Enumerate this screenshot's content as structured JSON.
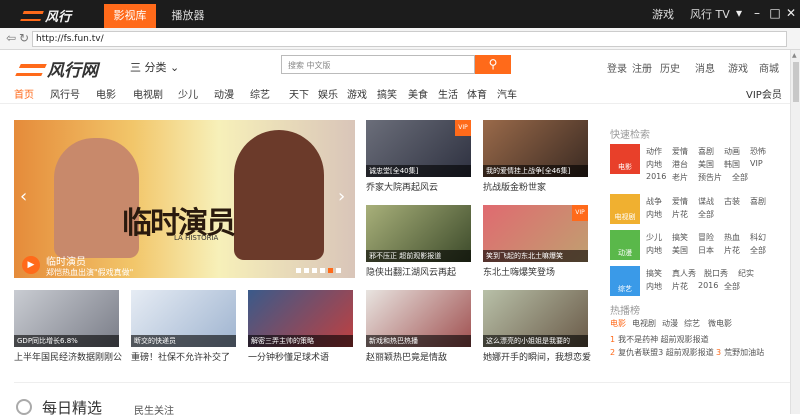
{
  "titlebar": {
    "logo": "风行",
    "tab_movies": "影视库",
    "tab_player": "播放器",
    "games": "游戏",
    "tv": "风行 TV"
  },
  "addressbar": {
    "url": "http://fs.fun.tv/"
  },
  "header": {
    "logo": "风行网",
    "category": "三 分类",
    "search_placeholder": "搜索 中文版",
    "links": [
      "登录",
      "注册",
      "历史",
      "消息",
      "游戏",
      "商城"
    ]
  },
  "nav": [
    "首页",
    "风行号",
    "电影",
    "电视剧",
    "少儿",
    "动漫",
    "综艺",
    "天下",
    "娱乐",
    "游戏",
    "搞笑",
    "美食",
    "生活",
    "体育",
    "汽车"
  ],
  "nav_vip": "VIP会员",
  "hero": {
    "big_text": "临时演员",
    "sub_text": "LA HISTORIA",
    "title": "临时演员",
    "subtitle": "郑恺热血出演\"假戏真做\""
  },
  "cards_row1": [
    {
      "cap": "诚忠堂[全40集]",
      "title": "乔家大院再起风云"
    },
    {
      "cap": "我的爱情挂上战争[全46集]",
      "title": "抗战版金粉世家"
    },
    {
      "cap": "邪不压正 超前观影报道",
      "title": "隐侠出翻江湖风云再起"
    },
    {
      "cap": "笑到飞起的东北土嘛爆笑",
      "title": "东北土嗨爆笑登场"
    }
  ],
  "cards_row2": [
    {
      "cap": "GDP同比增长6.8%",
      "title": "上半年国民经济数据刚刚公"
    },
    {
      "cap": "断交的快递员",
      "title": "重磅！社保不允许补交了"
    },
    {
      "cap": "解密三弄主帅的策略",
      "title": "一分钟秒懂足球术语"
    },
    {
      "cap": "新戏和热巴热播",
      "title": "赵丽颖热巴竟是情敌"
    },
    {
      "cap": "这么漂亮的小姐姐是我要的",
      "title": "她娜开手的瞬间，我想恋爱"
    }
  ],
  "quick_search": {
    "title": "快速检索",
    "blocks": [
      {
        "label": "电影",
        "rows": [
          [
            "动作",
            "爱情",
            "喜剧",
            "动画",
            "恐怖"
          ],
          [
            "内地",
            "港台",
            "美国",
            "韩国",
            "VIP"
          ],
          [
            "2016",
            "老片",
            "预告片",
            "全部"
          ]
        ]
      },
      {
        "label": "电视剧",
        "rows": [
          [
            "战争",
            "爱情",
            "谍战",
            "古装",
            "喜剧"
          ],
          [
            "内地",
            "片花",
            "全部"
          ]
        ]
      },
      {
        "label": "动漫",
        "rows": [
          [
            "少儿",
            "搞笑",
            "冒险",
            "热血",
            "科幻"
          ],
          [
            "内地",
            "美国",
            "日本",
            "片花",
            "全部"
          ]
        ]
      },
      {
        "label": "综艺",
        "rows": [
          [
            "搞笑",
            "真人秀",
            "脱口秀",
            "纪实"
          ],
          [
            "内地",
            "片花",
            "2016",
            "全部"
          ]
        ]
      }
    ]
  },
  "hot": {
    "title": "热播榜",
    "tabs": [
      "电影",
      "电视剧",
      "动漫",
      "综艺",
      "微电影"
    ],
    "items": [
      "我不是药神 超前观影报道",
      "复仇者联盟3 超前观影报道",
      "荒野加油站"
    ]
  },
  "daily": {
    "title": "每日精选",
    "sub": "民生关注"
  },
  "colors": {
    "accent": "#ff6a1a",
    "titlebar": "#1c1c1c",
    "movie": "#e8402a",
    "tv": "#f0b030",
    "anime": "#5ab84a",
    "variety": "#3a9ae8"
  }
}
